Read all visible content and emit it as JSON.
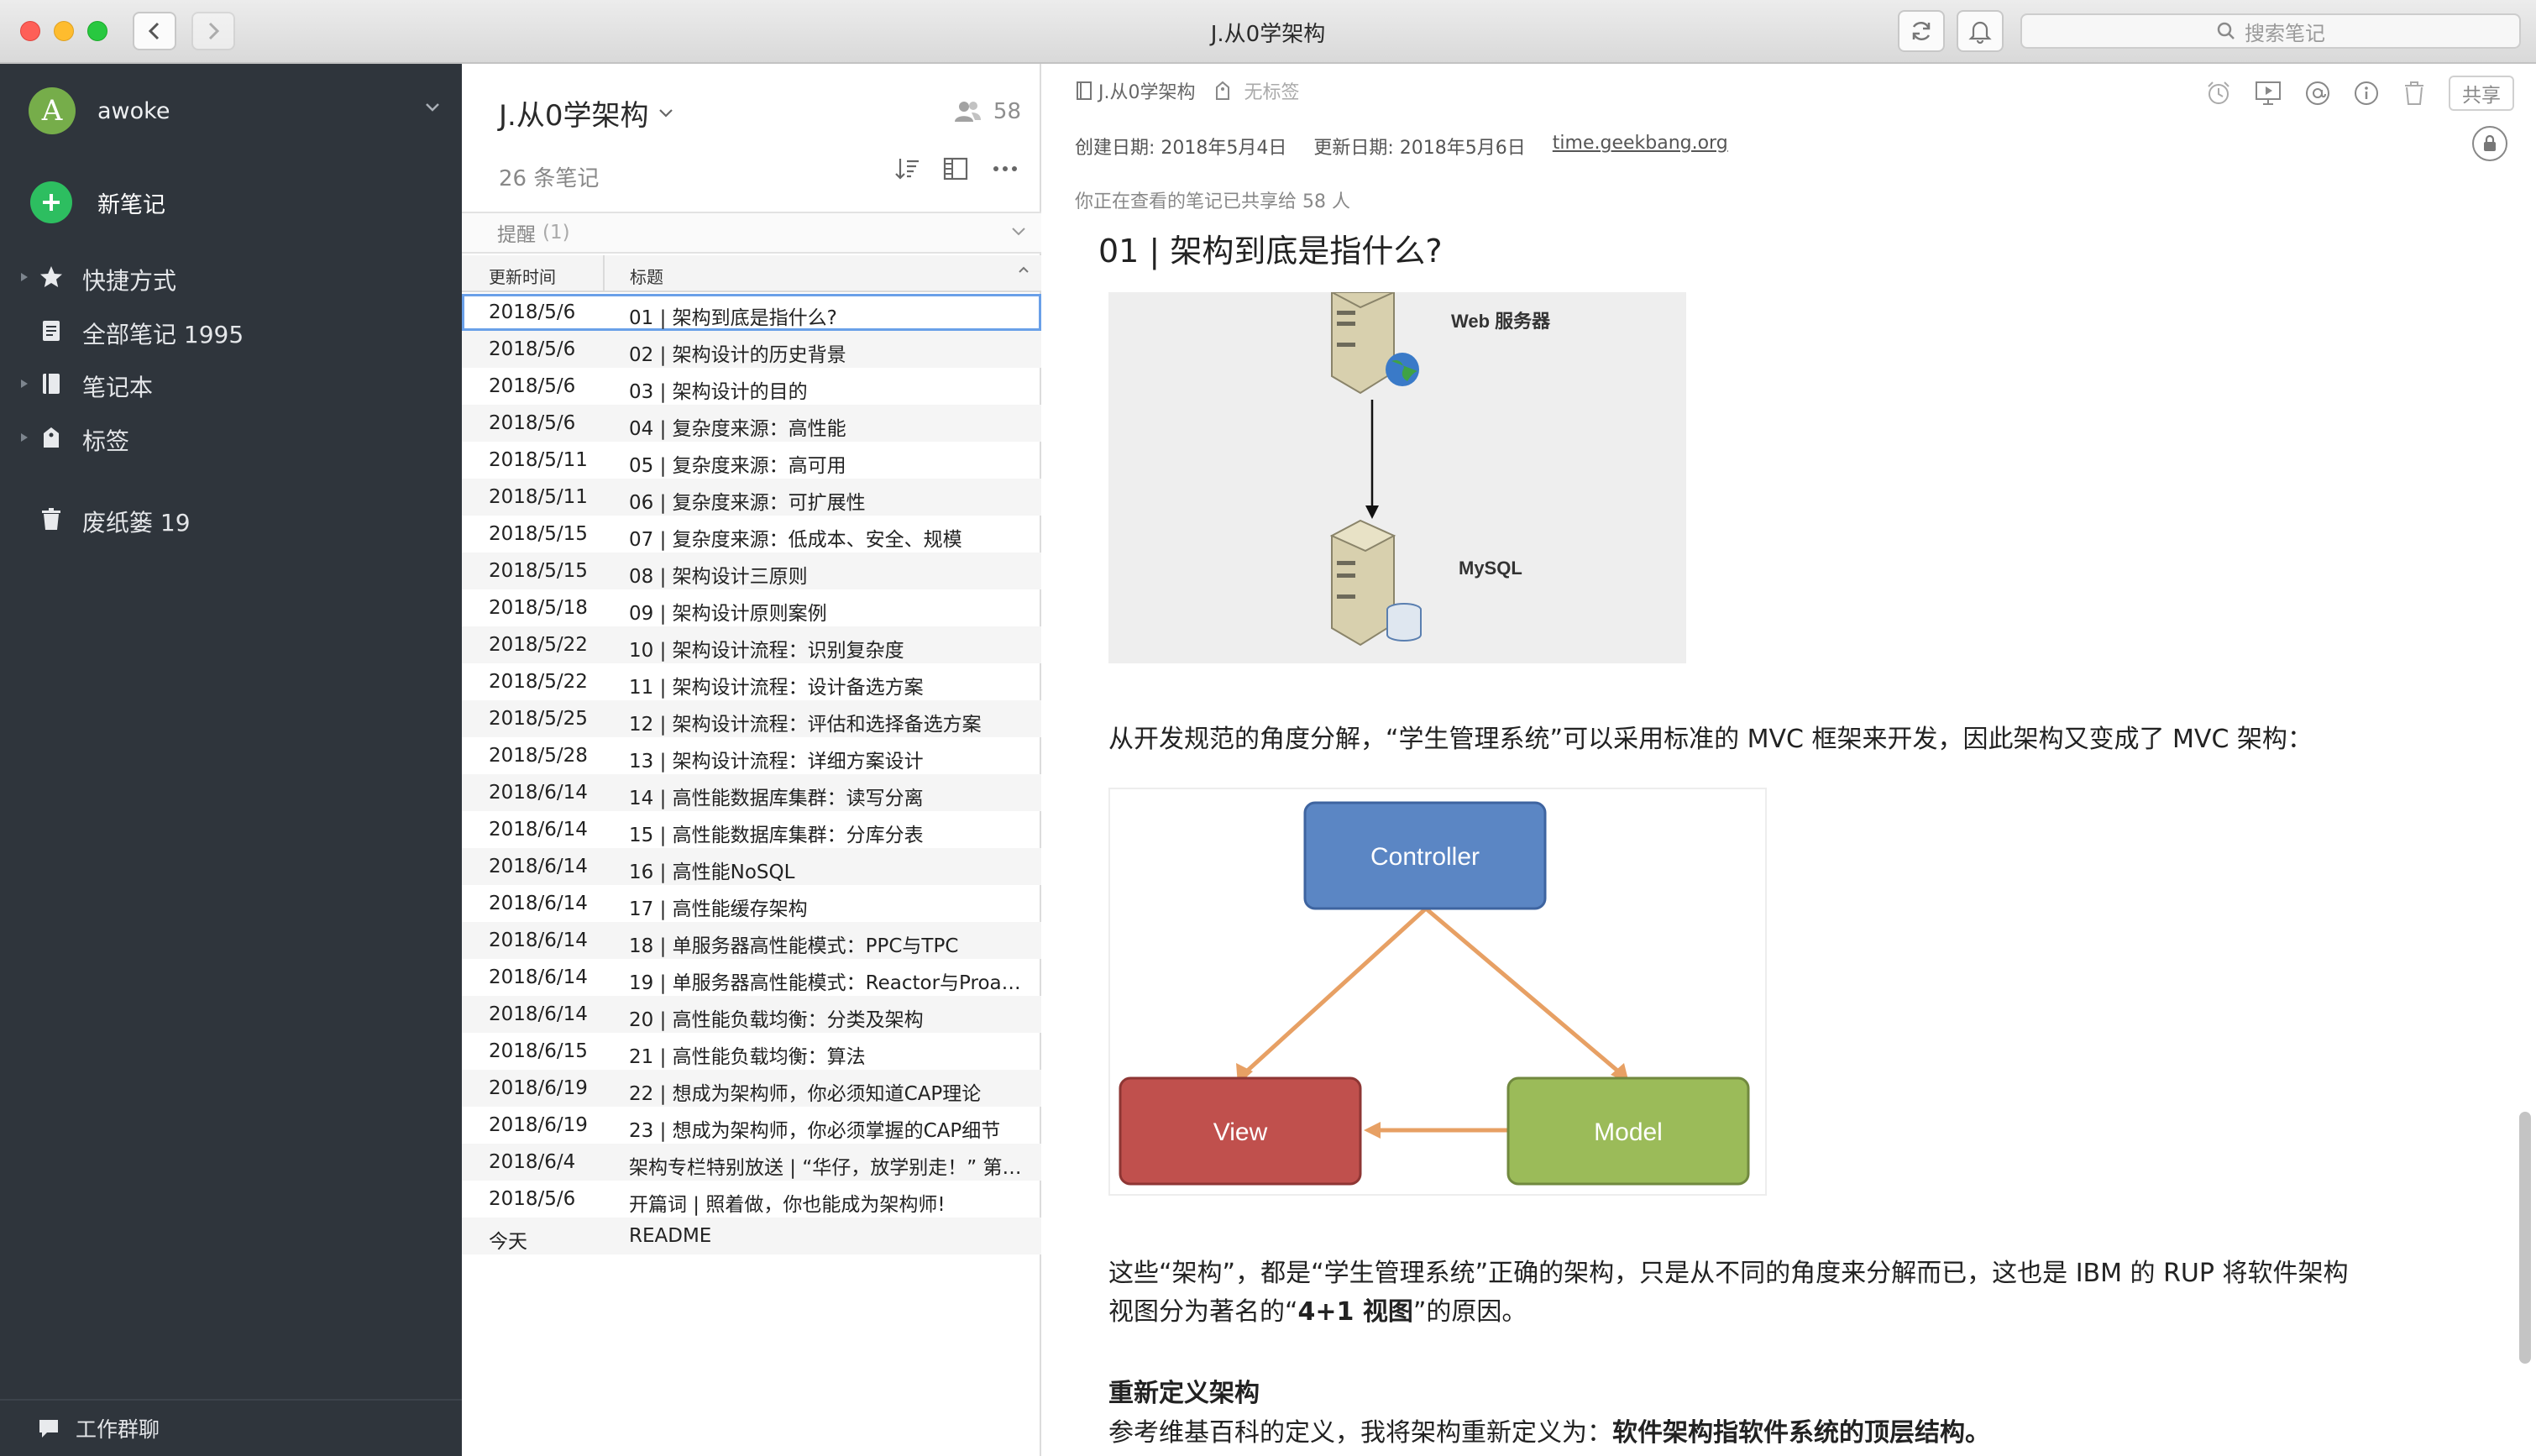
{
  "window": {
    "title": "J.从0学架构",
    "search_placeholder": "搜索笔记"
  },
  "sidebar": {
    "account": "awoke",
    "avatar_letter": "A",
    "new_note": "新笔记",
    "items": [
      {
        "label": "快捷方式",
        "icon": "star-icon"
      },
      {
        "label": "全部笔记 1995",
        "icon": "notes-icon"
      },
      {
        "label": "笔记本",
        "icon": "notebook-icon"
      },
      {
        "label": "标签",
        "icon": "tag-icon"
      },
      {
        "label": "废纸篓 19",
        "icon": "trash-icon"
      }
    ],
    "bottom": "工作群聊"
  },
  "notelist": {
    "notebook_title": "J.从0学架构",
    "shared_count": "58",
    "note_count": "26 条笔记",
    "reminder_label": "提醒",
    "reminder_count": "(1)",
    "col_updated": "更新时间",
    "col_title": "标题",
    "rows": [
      {
        "date": "2018/5/6",
        "title": "01 | 架构到底是指什么?"
      },
      {
        "date": "2018/5/6",
        "title": "02 | 架构设计的历史背景"
      },
      {
        "date": "2018/5/6",
        "title": "03 | 架构设计的目的"
      },
      {
        "date": "2018/5/6",
        "title": "04 | 复杂度来源：高性能"
      },
      {
        "date": "2018/5/11",
        "title": "05 | 复杂度来源：高可用"
      },
      {
        "date": "2018/5/11",
        "title": "06 | 复杂度来源：可扩展性"
      },
      {
        "date": "2018/5/15",
        "title": "07 | 复杂度来源：低成本、安全、规模"
      },
      {
        "date": "2018/5/15",
        "title": "08 | 架构设计三原则"
      },
      {
        "date": "2018/5/18",
        "title": "09 | 架构设计原则案例"
      },
      {
        "date": "2018/5/22",
        "title": "10 | 架构设计流程：识别复杂度"
      },
      {
        "date": "2018/5/22",
        "title": "11 | 架构设计流程：设计备选方案"
      },
      {
        "date": "2018/5/25",
        "title": "12 | 架构设计流程：评估和选择备选方案"
      },
      {
        "date": "2018/5/28",
        "title": "13 | 架构设计流程：详细方案设计"
      },
      {
        "date": "2018/6/14",
        "title": "14 | 高性能数据库集群：读写分离"
      },
      {
        "date": "2018/6/14",
        "title": "15 | 高性能数据库集群：分库分表"
      },
      {
        "date": "2018/6/14",
        "title": "16 | 高性能NoSQL"
      },
      {
        "date": "2018/6/14",
        "title": "17 | 高性能缓存架构"
      },
      {
        "date": "2018/6/14",
        "title": "18 | 单服务器高性能模式：PPC与TPC"
      },
      {
        "date": "2018/6/14",
        "title": "19 | 单服务器高性能模式：Reactor与Proa…"
      },
      {
        "date": "2018/6/14",
        "title": "20 | 高性能负载均衡：分类及架构"
      },
      {
        "date": "2018/6/15",
        "title": "21 | 高性能负载均衡：算法"
      },
      {
        "date": "2018/6/19",
        "title": "22 | 想成为架构师，你必须知道CAP理论"
      },
      {
        "date": "2018/6/19",
        "title": "23 | 想成为架构师，你必须掌握的CAP细节"
      },
      {
        "date": "2018/6/4",
        "title": "架构专栏特别放送 | “华仔，放学别走！” 第…"
      },
      {
        "date": "2018/5/6",
        "title": "开篇词 | 照着做，你也能成为架构师!"
      },
      {
        "date": "今天",
        "title": "README"
      }
    ]
  },
  "editor": {
    "notebook": "J.从0学架构",
    "tag": "无标签",
    "share_label": "共享",
    "created": "创建日期: 2018年5月4日",
    "updated": "更新日期: 2018年5月6日",
    "source_url": "time.geekbang.org",
    "shared_info": "你正在查看的笔记已共享给 58 人",
    "title": "01 | 架构到底是指什么?",
    "fig1_web": "Web 服务器",
    "fig1_mysql": "MySQL",
    "para1": "从开发规范的角度分解，“学生管理系统”可以采用标准的 MVC 框架来开发，因此架构又变成了 MVC 架构：",
    "fig2_controller": "Controller",
    "fig2_view": "View",
    "fig2_model": "Model",
    "para2_line1": "这些“架构”，都是“学生管理系统”正确的架构，只是从不同的角度来分解而已，这也是 IBM 的 RUP 将软件架构",
    "para2_line2_a": "视图分为著名的“",
    "para2_line2_b": "4+1 视图",
    "para2_line2_c": "”的原因。",
    "subheading": "重新定义架构",
    "para3_a": "参考维基百科的定义，我将架构重新定义为：",
    "para3_b": "软件架构指软件系统的顶层结构。"
  },
  "colors": {
    "sidebar_bg": "#2f353c",
    "accent_green": "#2dbe60",
    "selection_border": "#6aa0e8",
    "controller": "#5b86c4",
    "view": "#c0504d",
    "model": "#9bbb59"
  }
}
